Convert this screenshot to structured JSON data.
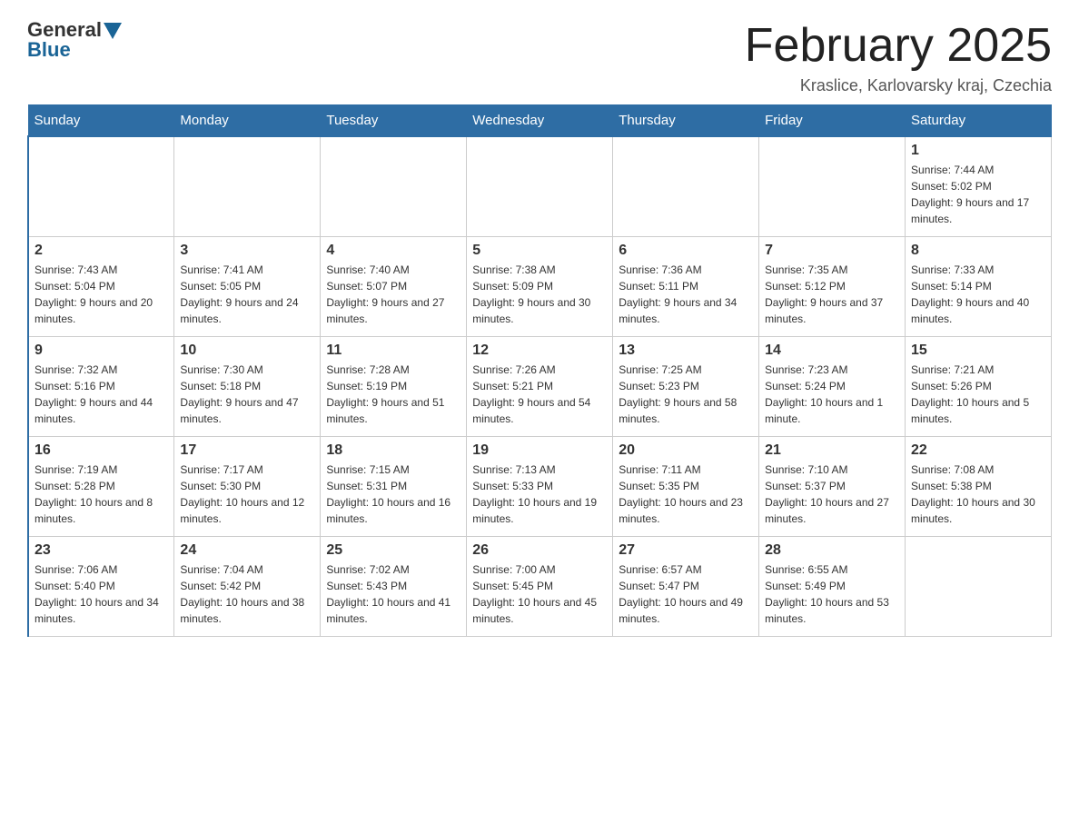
{
  "header": {
    "logo_text_general": "General",
    "logo_text_blue": "Blue",
    "title": "February 2025",
    "subtitle": "Kraslice, Karlovarsky kraj, Czechia"
  },
  "days_of_week": [
    "Sunday",
    "Monday",
    "Tuesday",
    "Wednesday",
    "Thursday",
    "Friday",
    "Saturday"
  ],
  "weeks": [
    [
      {
        "day": "",
        "info": ""
      },
      {
        "day": "",
        "info": ""
      },
      {
        "day": "",
        "info": ""
      },
      {
        "day": "",
        "info": ""
      },
      {
        "day": "",
        "info": ""
      },
      {
        "day": "",
        "info": ""
      },
      {
        "day": "1",
        "info": "Sunrise: 7:44 AM\nSunset: 5:02 PM\nDaylight: 9 hours and 17 minutes."
      }
    ],
    [
      {
        "day": "2",
        "info": "Sunrise: 7:43 AM\nSunset: 5:04 PM\nDaylight: 9 hours and 20 minutes."
      },
      {
        "day": "3",
        "info": "Sunrise: 7:41 AM\nSunset: 5:05 PM\nDaylight: 9 hours and 24 minutes."
      },
      {
        "day": "4",
        "info": "Sunrise: 7:40 AM\nSunset: 5:07 PM\nDaylight: 9 hours and 27 minutes."
      },
      {
        "day": "5",
        "info": "Sunrise: 7:38 AM\nSunset: 5:09 PM\nDaylight: 9 hours and 30 minutes."
      },
      {
        "day": "6",
        "info": "Sunrise: 7:36 AM\nSunset: 5:11 PM\nDaylight: 9 hours and 34 minutes."
      },
      {
        "day": "7",
        "info": "Sunrise: 7:35 AM\nSunset: 5:12 PM\nDaylight: 9 hours and 37 minutes."
      },
      {
        "day": "8",
        "info": "Sunrise: 7:33 AM\nSunset: 5:14 PM\nDaylight: 9 hours and 40 minutes."
      }
    ],
    [
      {
        "day": "9",
        "info": "Sunrise: 7:32 AM\nSunset: 5:16 PM\nDaylight: 9 hours and 44 minutes."
      },
      {
        "day": "10",
        "info": "Sunrise: 7:30 AM\nSunset: 5:18 PM\nDaylight: 9 hours and 47 minutes."
      },
      {
        "day": "11",
        "info": "Sunrise: 7:28 AM\nSunset: 5:19 PM\nDaylight: 9 hours and 51 minutes."
      },
      {
        "day": "12",
        "info": "Sunrise: 7:26 AM\nSunset: 5:21 PM\nDaylight: 9 hours and 54 minutes."
      },
      {
        "day": "13",
        "info": "Sunrise: 7:25 AM\nSunset: 5:23 PM\nDaylight: 9 hours and 58 minutes."
      },
      {
        "day": "14",
        "info": "Sunrise: 7:23 AM\nSunset: 5:24 PM\nDaylight: 10 hours and 1 minute."
      },
      {
        "day": "15",
        "info": "Sunrise: 7:21 AM\nSunset: 5:26 PM\nDaylight: 10 hours and 5 minutes."
      }
    ],
    [
      {
        "day": "16",
        "info": "Sunrise: 7:19 AM\nSunset: 5:28 PM\nDaylight: 10 hours and 8 minutes."
      },
      {
        "day": "17",
        "info": "Sunrise: 7:17 AM\nSunset: 5:30 PM\nDaylight: 10 hours and 12 minutes."
      },
      {
        "day": "18",
        "info": "Sunrise: 7:15 AM\nSunset: 5:31 PM\nDaylight: 10 hours and 16 minutes."
      },
      {
        "day": "19",
        "info": "Sunrise: 7:13 AM\nSunset: 5:33 PM\nDaylight: 10 hours and 19 minutes."
      },
      {
        "day": "20",
        "info": "Sunrise: 7:11 AM\nSunset: 5:35 PM\nDaylight: 10 hours and 23 minutes."
      },
      {
        "day": "21",
        "info": "Sunrise: 7:10 AM\nSunset: 5:37 PM\nDaylight: 10 hours and 27 minutes."
      },
      {
        "day": "22",
        "info": "Sunrise: 7:08 AM\nSunset: 5:38 PM\nDaylight: 10 hours and 30 minutes."
      }
    ],
    [
      {
        "day": "23",
        "info": "Sunrise: 7:06 AM\nSunset: 5:40 PM\nDaylight: 10 hours and 34 minutes."
      },
      {
        "day": "24",
        "info": "Sunrise: 7:04 AM\nSunset: 5:42 PM\nDaylight: 10 hours and 38 minutes."
      },
      {
        "day": "25",
        "info": "Sunrise: 7:02 AM\nSunset: 5:43 PM\nDaylight: 10 hours and 41 minutes."
      },
      {
        "day": "26",
        "info": "Sunrise: 7:00 AM\nSunset: 5:45 PM\nDaylight: 10 hours and 45 minutes."
      },
      {
        "day": "27",
        "info": "Sunrise: 6:57 AM\nSunset: 5:47 PM\nDaylight: 10 hours and 49 minutes."
      },
      {
        "day": "28",
        "info": "Sunrise: 6:55 AM\nSunset: 5:49 PM\nDaylight: 10 hours and 53 minutes."
      },
      {
        "day": "",
        "info": ""
      }
    ]
  ]
}
